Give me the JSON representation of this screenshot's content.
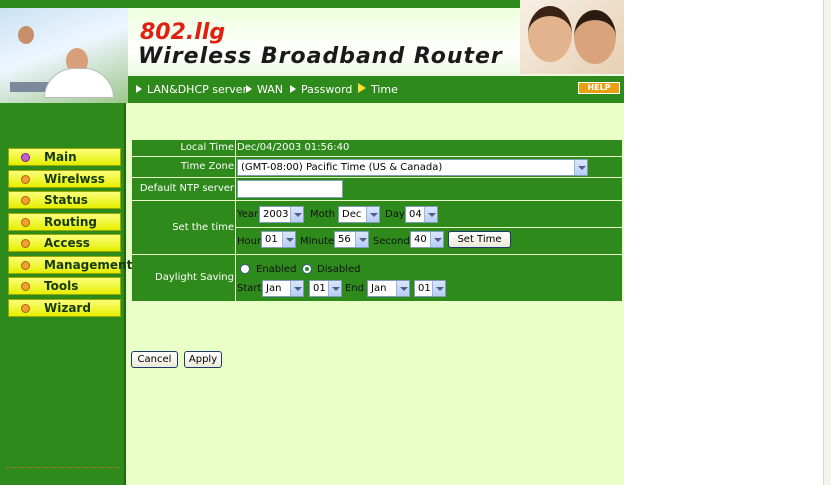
{
  "header": {
    "model": "802.llg",
    "title": "Wireless Broadband Router",
    "nav": [
      {
        "label": "LAN&DHCP server"
      },
      {
        "label": "WAN"
      },
      {
        "label": "Password"
      },
      {
        "label": "Time",
        "active": true
      }
    ],
    "help_label": "HELP"
  },
  "sidebar": {
    "items": [
      {
        "label": "Main",
        "active": true
      },
      {
        "label": "Wirelwss"
      },
      {
        "label": "Status"
      },
      {
        "label": "Routing"
      },
      {
        "label": "Access"
      },
      {
        "label": "Management"
      },
      {
        "label": "Tools"
      },
      {
        "label": "Wizard"
      }
    ]
  },
  "form": {
    "local_time": {
      "label": "Local Time",
      "value": "Dec/04/2003 01:56:40"
    },
    "time_zone": {
      "label": "Time Zone",
      "value": "(GMT-08:00) Pacific Time (US & Canada)"
    },
    "ntp": {
      "label": "Default NTP server",
      "value": ""
    },
    "set_time": {
      "label": "Set the time",
      "year_label": "Year",
      "year": "2003",
      "month_label": "Moth",
      "month": "Dec",
      "day_label": "Day",
      "day": "04",
      "hour_label": "Hour",
      "hour": "01",
      "minute_label": "Minute",
      "minute": "56",
      "second_label": "Second",
      "second": "40",
      "set_button": "Set Time"
    },
    "daylight": {
      "label": "Daylight Saving",
      "enabled_label": "Enabled",
      "disabled_label": "Disabled",
      "selected": "Disabled",
      "start_label": "Start",
      "start_month": "Jan",
      "start_day": "01",
      "end_label": "End",
      "end_month": "Jan",
      "end_day": "01"
    }
  },
  "actions": {
    "cancel": "Cancel",
    "apply": "Apply"
  },
  "colors": {
    "green": "#2f8a1c",
    "light_green": "#eaffc8",
    "sidebar_button": "#e5ee00",
    "brand_red": "#e02010"
  }
}
